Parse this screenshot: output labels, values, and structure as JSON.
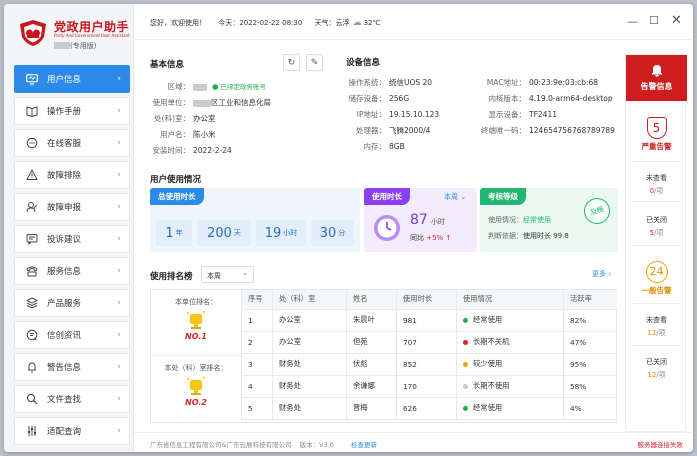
{
  "app": {
    "title_cn": "党政用户助手",
    "title_en": "Party And Government User Assistant",
    "edition": "(专用版)"
  },
  "topbar": {
    "greeting": "您好，欢迎使用！",
    "today_label": "今天：",
    "today_value": "2022-02-22 08:30",
    "weather_label": "天气：",
    "weather_value": "云浮",
    "temperature": "32℃"
  },
  "sidebar": {
    "items": [
      {
        "label": "用户信息",
        "icon": "monitor-icon"
      },
      {
        "label": "操作手册",
        "icon": "book-icon"
      },
      {
        "label": "在线客服",
        "icon": "chat-icon"
      },
      {
        "label": "故障排除",
        "icon": "warning-icon"
      },
      {
        "label": "故障申报",
        "icon": "user-report-icon"
      },
      {
        "label": "投诉建议",
        "icon": "message-icon"
      },
      {
        "label": "服务信息",
        "icon": "phone-icon"
      },
      {
        "label": "产品服务",
        "icon": "layers-icon"
      },
      {
        "label": "信创资讯",
        "icon": "news-icon"
      },
      {
        "label": "警告信息",
        "icon": "bell-icon"
      },
      {
        "label": "文件查找",
        "icon": "search-icon"
      },
      {
        "label": "适配查询",
        "icon": "sliders-icon"
      }
    ]
  },
  "basic_info": {
    "title": "基本信息",
    "region_label": "区域：",
    "bound_text": "已绑定政务账号",
    "unit_label": "使用单位：",
    "unit_value": "区工业和信息化局",
    "dept_label": "处(科)室：",
    "dept_value": "办公室",
    "user_label": "用户名：",
    "user_value": "陈小米",
    "install_label": "安装时间：",
    "install_value": "2022-2-24"
  },
  "device_info": {
    "title": "设备信息",
    "left": [
      {
        "label": "操作系统：",
        "value": "统信UOS 20"
      },
      {
        "label": "储存设备：",
        "value": "256G"
      },
      {
        "label": "IP地址：",
        "value": "19.15.10.123"
      },
      {
        "label": "处理器：",
        "value": "飞腾2000/4"
      },
      {
        "label": "内存：",
        "value": "8GB"
      }
    ],
    "right": [
      {
        "label": "MAC地址：",
        "value": "00:23:9e:03:cb:68"
      },
      {
        "label": "内核版本：",
        "value": "4.19.0-arm64-desktop"
      },
      {
        "label": "显示设备：",
        "value": "TF2411"
      },
      {
        "label": "终端唯一码：",
        "value": "124654756768789789"
      }
    ]
  },
  "usage": {
    "title": "用户使用情况",
    "total": {
      "header": "总使用时长",
      "tiles": [
        {
          "num": "1",
          "unit": "年"
        },
        {
          "num": "200",
          "unit": "天"
        },
        {
          "num": "19",
          "unit": "小时"
        },
        {
          "num": "30",
          "unit": "分"
        }
      ]
    },
    "duration": {
      "header": "使用时长",
      "period": "本周",
      "hours": "87",
      "hours_unit": "小时",
      "compare_label": "同比",
      "compare_value": "+5%"
    },
    "assessment": {
      "header": "考核等级",
      "status_label": "使用情况：",
      "status_value": "经常使用",
      "basis_label": "判断依据：",
      "basis_value": "使用时长 99.8",
      "stamp": "及格"
    }
  },
  "ranking": {
    "title": "使用排名榜",
    "period": "本周",
    "more": "更多",
    "unit_rank_label": "本单位排名：",
    "unit_rank": "NO.1",
    "dept_rank_label": "本处（科）室排名：",
    "dept_rank": "NO.2",
    "headers": [
      "序号",
      "处（科）室",
      "姓名",
      "使用时长",
      "使用情况",
      "活跃率"
    ],
    "rows": [
      {
        "no": "1",
        "dept": "办公室",
        "name": "朱晨叶",
        "hours": "981",
        "status": "经常使用",
        "color": "#22b14c",
        "rate": "82%"
      },
      {
        "no": "2",
        "dept": "办公室",
        "name": "但苑",
        "hours": "707",
        "status": "长期不关机",
        "color": "#d9252a",
        "rate": "47%"
      },
      {
        "no": "3",
        "dept": "财务处",
        "name": "伏彪",
        "hours": "852",
        "status": "较少使用",
        "color": "#f2a100",
        "rate": "95%"
      },
      {
        "no": "4",
        "dept": "财务处",
        "name": "余谦娜",
        "hours": "170",
        "status": "长期不使用",
        "color": "#c8c8c8",
        "rate": "58%"
      },
      {
        "no": "5",
        "dept": "财务处",
        "name": "晋梅",
        "hours": "626",
        "status": "经常使用",
        "color": "#22b14c",
        "rate": "4%"
      }
    ]
  },
  "alarm": {
    "header": "告警信息",
    "severe": {
      "count": "5",
      "label": "严重告警"
    },
    "severe_unread": {
      "label": "未查看",
      "count": "0",
      "unit": "/项"
    },
    "severe_closed": {
      "label": "已关闭",
      "count": "5",
      "unit": "/项"
    },
    "general": {
      "count": "24",
      "label": "一般告警"
    },
    "general_unread": {
      "label": "未查看",
      "count": "12",
      "unit": "/项"
    },
    "general_closed": {
      "label": "已关闭",
      "count": "12",
      "unit": "/项"
    }
  },
  "footer": {
    "company": "广东省信息工程有限公司&广东云展科技有限公司",
    "version_label": "版本：",
    "version": "V3.0",
    "update": "检查更新",
    "server_status": "服务器连接失败"
  },
  "colors": {
    "primary": "#2c8be8",
    "brand_red": "#c8161d",
    "purple": "#8a3ff0",
    "green": "#22b573",
    "orange": "#f2a100"
  }
}
